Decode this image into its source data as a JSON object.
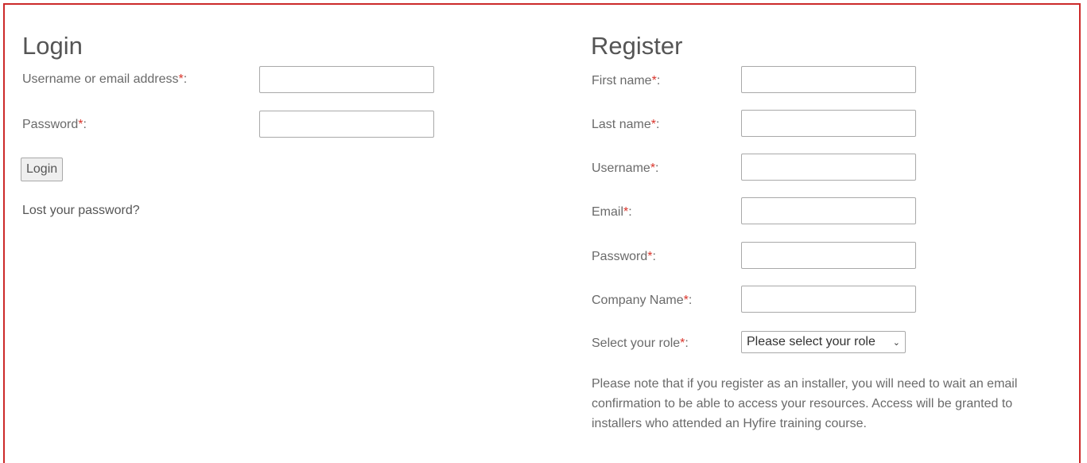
{
  "login": {
    "title": "Login",
    "username_label": "Username or email address",
    "password_label": "Password",
    "required_mark": "*",
    "colon": ":",
    "username_value": "",
    "password_value": "",
    "submit_label": "Login",
    "lost_password": "Lost your password?"
  },
  "register": {
    "title": "Register",
    "fields": [
      {
        "label": "First name",
        "value": ""
      },
      {
        "label": "Last name",
        "value": ""
      },
      {
        "label": "Username",
        "value": ""
      },
      {
        "label": "Email",
        "value": ""
      },
      {
        "label": "Password",
        "value": ""
      },
      {
        "label": "Company Name",
        "value": ""
      }
    ],
    "role_label": "Select your role",
    "role_selected": "Please select your role",
    "note": "Please note that if you register as an installer, you will need to wait an email confirmation to be able to access your resources. Access will be granted to installers who attended an Hyfire training course."
  },
  "colors": {
    "border": "#cc2a2a",
    "required": "#d9342b"
  }
}
